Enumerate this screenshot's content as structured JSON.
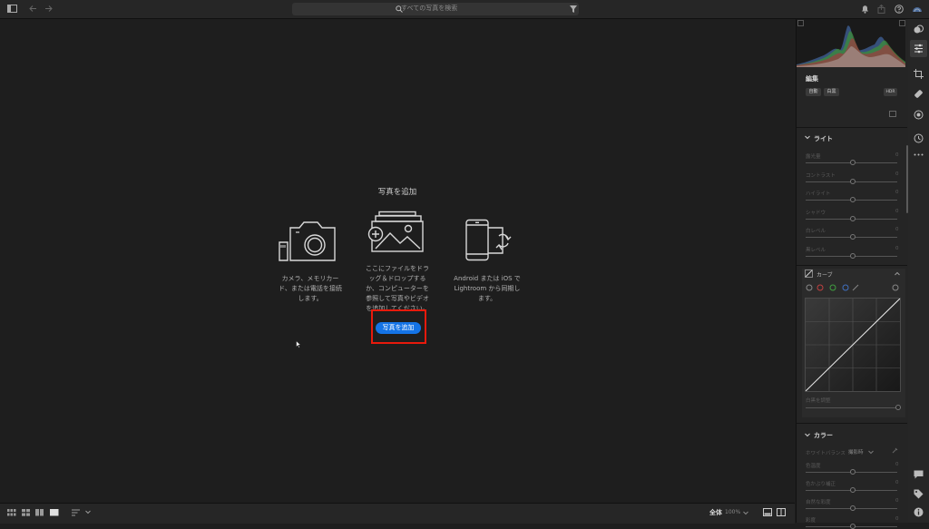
{
  "search": {
    "placeholder": "すべての写真を検索"
  },
  "empty_state": {
    "title": "写真を追加",
    "camera_caption": "カメラ、メモリカード、または電話を接続します。",
    "drag_caption": "ここにファイルをドラッグ＆ドロップするか、コンピューターを参照して写真やビデオを追加してください。",
    "mobile_caption": "Android または iOS で Lightroom から同期します。",
    "add_button": "写真を追加"
  },
  "bottom": {
    "zoom_label": "全体",
    "zoom_value": "100%"
  },
  "panel": {
    "edit_title": "編集",
    "auto_button": "自動",
    "bw_button": "白黒",
    "hdr_badge": "HDR",
    "light_section": "ライト",
    "light_sliders": [
      {
        "label": "露光量",
        "value": "0"
      },
      {
        "label": "コントラスト",
        "value": "0"
      },
      {
        "label": "ハイライト",
        "value": "0"
      },
      {
        "label": "シャドウ",
        "value": "0"
      },
      {
        "label": "白レベル",
        "value": "0"
      },
      {
        "label": "黒レベル",
        "value": "0"
      }
    ],
    "curve_label": "カーブ",
    "curve_slider_label": "白黒を調整",
    "color_section": "カラー",
    "wb_label": "ホワイトバランス",
    "wb_value": "撮影時",
    "color_sliders": [
      {
        "label": "色温度",
        "value": "0"
      },
      {
        "label": "色かぶり補正",
        "value": "0"
      },
      {
        "label": "自然な彩度",
        "value": "0"
      },
      {
        "label": "彩度",
        "value": "0"
      }
    ]
  },
  "colors": {
    "accent": "#1473e6",
    "highlight": "#e81a0c"
  }
}
